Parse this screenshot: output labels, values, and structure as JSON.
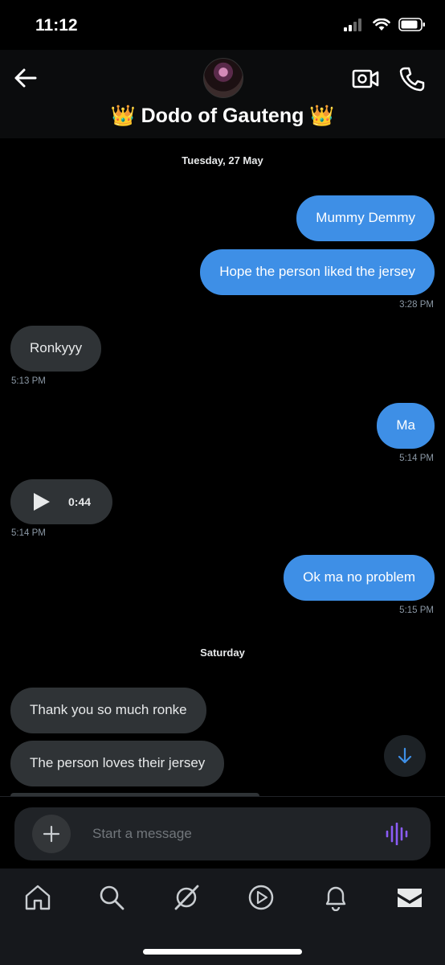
{
  "status": {
    "time": "11:12"
  },
  "header": {
    "title": "👑 Dodo of Gauteng 👑"
  },
  "dates": {
    "first": "Tuesday, 27 May",
    "second": "Saturday"
  },
  "messages": {
    "m1": "Mummy Demmy",
    "m2": "Hope the person liked the jersey",
    "t2": "3:28 PM",
    "m3": "Ronkyyy",
    "t3": "5:13 PM",
    "m4": "Ma",
    "t4": "5:14 PM",
    "voice_duration": "0:44",
    "t5": "5:14 PM",
    "m6": "Ok ma no problem",
    "t6": "5:15 PM",
    "m7": "Thank you so much ronke",
    "m8": "The person loves their jersey"
  },
  "composer": {
    "placeholder": "Start a message"
  },
  "colors": {
    "outgoing": "#3e8fe6",
    "incoming": "#2f3336",
    "accent": "#8b5cf6"
  },
  "icons": {
    "nav": [
      "home-icon",
      "search-icon",
      "grok-icon",
      "video-icon",
      "bell-icon",
      "mail-icon"
    ],
    "header": [
      "back-arrow-icon",
      "video-call-icon",
      "phone-icon"
    ]
  }
}
